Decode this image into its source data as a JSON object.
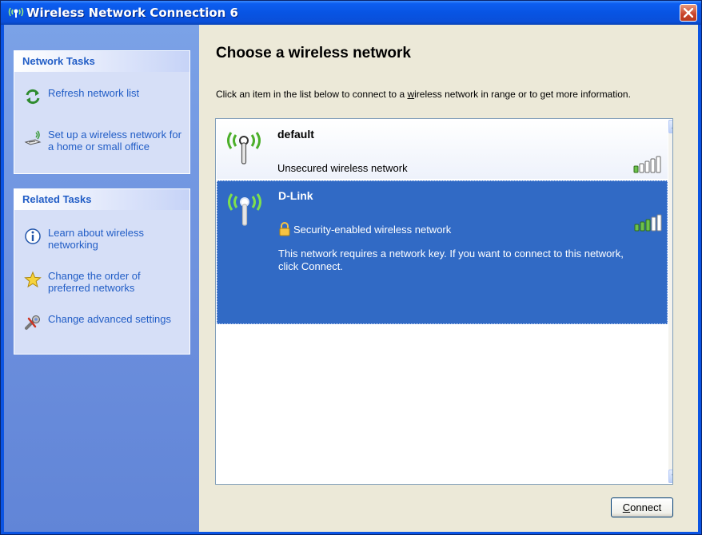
{
  "window": {
    "title": "Wireless Network Connection 6",
    "title_icon": "wireless-antenna-icon",
    "close_icon": "close-icon"
  },
  "sidebar": {
    "network_tasks": {
      "heading": "Network Tasks",
      "items": [
        {
          "label": "Refresh network list",
          "icon": "refresh-icon"
        },
        {
          "label": "Set up a wireless network for a home or small office",
          "icon": "setup-wizard-icon"
        }
      ]
    },
    "related_tasks": {
      "heading": "Related Tasks",
      "items": [
        {
          "label": "Learn about wireless networking",
          "icon": "info-icon"
        },
        {
          "label": "Change the order of preferred networks",
          "icon": "star-icon"
        },
        {
          "label": "Change advanced settings",
          "icon": "settings-icon"
        }
      ]
    }
  },
  "main": {
    "heading": "Choose a wireless network",
    "instructions_part1": "Click an item in the list below to connect to a ",
    "instructions_link": "w",
    "instructions_part2": "ireless network in range or to get more information.",
    "networks": [
      {
        "name": "default",
        "description": "Unsecured wireless network",
        "signal_bars": 1,
        "signal_max": 5,
        "selected": false
      },
      {
        "name": "D-Link",
        "description": "Security-enabled wireless network",
        "detail": "This network requires a network key. If you want to connect to this network, click Connect.",
        "signal_bars": 3,
        "signal_max": 5,
        "selected": true
      }
    ],
    "connect_button_mnemonic": "C",
    "connect_button_rest": "onnect"
  },
  "colors": {
    "titlebar": "#0854e3",
    "sidebar": "#6c8fdd",
    "selection": "#316ac5",
    "link": "#215dc6",
    "signal_on": "#6cc14b",
    "signal_off": "#ffffff"
  }
}
